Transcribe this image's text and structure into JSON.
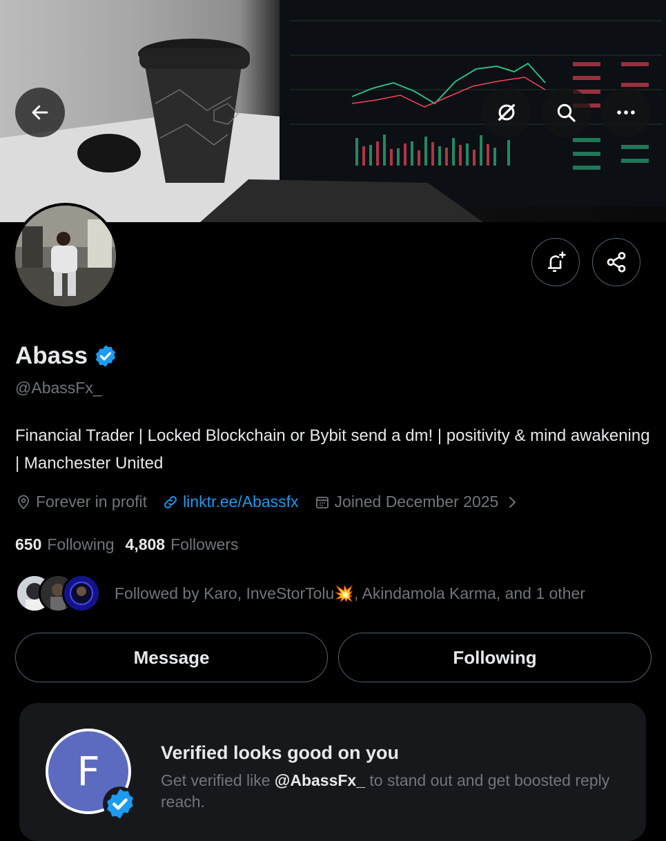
{
  "header": {
    "back_icon": "arrow-left-icon",
    "actions": [
      "disconnect-icon",
      "search-icon",
      "more-icon"
    ]
  },
  "profile": {
    "name": "Abass",
    "handle": "@AbassFx_",
    "bio": "Financial Trader | Locked Blockchain or Bybit send a dm! | positivity & mind awakening | Manchester United",
    "location": "Forever in profit",
    "website": "linktr.ee/Abassfx",
    "joined": "Joined December 2025",
    "following_count": "650",
    "following_label": "Following",
    "followers_count": "4,808",
    "followers_label": "Followers",
    "followed_by": "Followed by Karo, InveStorTolu💥, Akindamola Karma, and 1 other"
  },
  "buttons": {
    "message": "Message",
    "following": "Following"
  },
  "promo": {
    "avatar_letter": "F",
    "title": "Verified looks good on you",
    "text_prefix": "Get verified like ",
    "text_handle": "@AbassFx_",
    "text_suffix": " to stand out and get boosted reply reach."
  },
  "colors": {
    "accent": "#1d9bf0",
    "background": "#000000",
    "muted": "#71767b",
    "card": "#16181c"
  }
}
